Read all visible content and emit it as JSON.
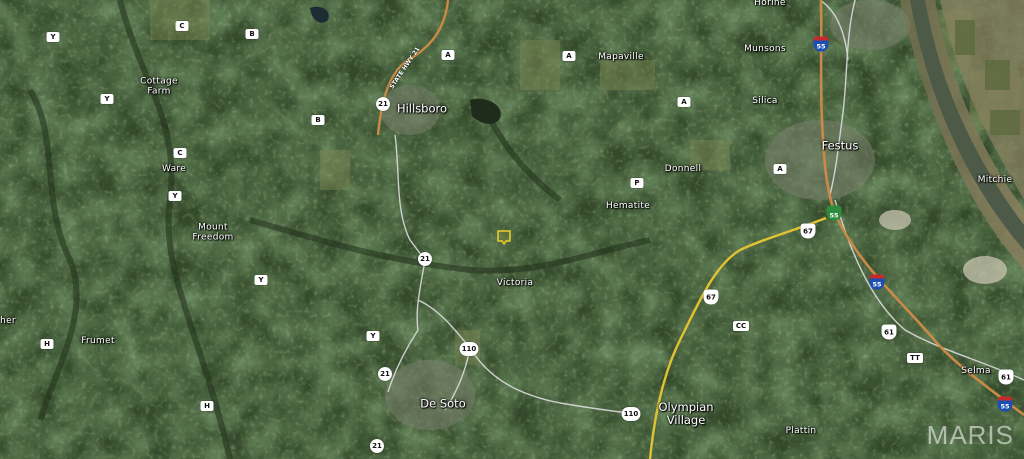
{
  "map": {
    "type": "satellite",
    "watermark": "MARIS",
    "places": [
      {
        "id": "hillsboro",
        "text": "Hillsboro",
        "kind": "city"
      },
      {
        "id": "festus",
        "text": "Festus",
        "kind": "city"
      },
      {
        "id": "de-soto",
        "text": "De Soto",
        "kind": "city"
      },
      {
        "id": "olympian-village",
        "text": "Olympian Village",
        "kind": "city"
      },
      {
        "id": "victoria",
        "text": "Victoria",
        "kind": "town"
      },
      {
        "id": "hematite",
        "text": "Hematite",
        "kind": "town"
      },
      {
        "id": "donnell",
        "text": "Donnell",
        "kind": "town"
      },
      {
        "id": "silica",
        "text": "Silica",
        "kind": "town"
      },
      {
        "id": "munsons",
        "text": "Munsons",
        "kind": "town"
      },
      {
        "id": "mapaville",
        "text": "Mapaville",
        "kind": "town"
      },
      {
        "id": "cottage-farm",
        "text": "Cottage Farm",
        "kind": "town"
      },
      {
        "id": "ware",
        "text": "Ware",
        "kind": "town"
      },
      {
        "id": "mount-freedom",
        "text": "Mount Freedom",
        "kind": "town"
      },
      {
        "id": "frumet",
        "text": "Frumet",
        "kind": "town"
      },
      {
        "id": "plattin",
        "text": "Plattin",
        "kind": "town"
      },
      {
        "id": "selma",
        "text": "Selma",
        "kind": "town"
      },
      {
        "id": "mitchie",
        "text": "Mitchie",
        "kind": "town"
      },
      {
        "id": "horine",
        "text": "Horine",
        "kind": "town"
      },
      {
        "id": "edge-left",
        "text": "her",
        "kind": "town"
      }
    ],
    "route_label": "STATE HWY 21",
    "letter_routes": [
      "Y",
      "C",
      "B",
      "A",
      "A",
      "A",
      "A",
      "Y",
      "B",
      "C",
      "Y",
      "Y",
      "Y",
      "H",
      "H",
      "P",
      "CC",
      "TT"
    ],
    "state_routes": [
      "21",
      "21",
      "21",
      "21",
      "110",
      "110",
      "61",
      "61",
      "67",
      "67"
    ],
    "interstates": [
      "55",
      "55",
      "55",
      "55"
    ],
    "colors": {
      "interstate_road": "#c98a46",
      "us_highway_road": "#e1c232",
      "state_road": "#dcdcdc",
      "pin": "#d9c22e"
    }
  }
}
